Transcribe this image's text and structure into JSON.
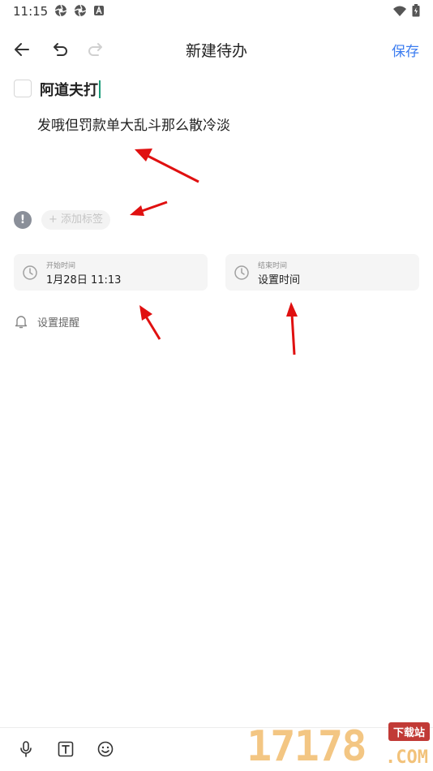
{
  "status_bar": {
    "time": "11:15"
  },
  "toolbar": {
    "title": "新建待办",
    "save_label": "保存"
  },
  "todo": {
    "title": "阿道夫打",
    "body": "发哦但罚款单大乱斗那么散冷淡"
  },
  "priority": {
    "symbol": "!"
  },
  "tag": {
    "label": "+ 添加标签"
  },
  "start_time": {
    "label": "开始时间",
    "value": "1月28日 11:13"
  },
  "end_time": {
    "label": "结束时间",
    "value": "设置时间"
  },
  "reminder": {
    "label": "设置提醒"
  },
  "watermark": {
    "number": "17178",
    "badge": "下载站",
    "suffix": ".COM"
  },
  "colors": {
    "accent": "#3b7cf0",
    "caret": "#1c9b7a",
    "annotation_arrow": "#e01010"
  }
}
